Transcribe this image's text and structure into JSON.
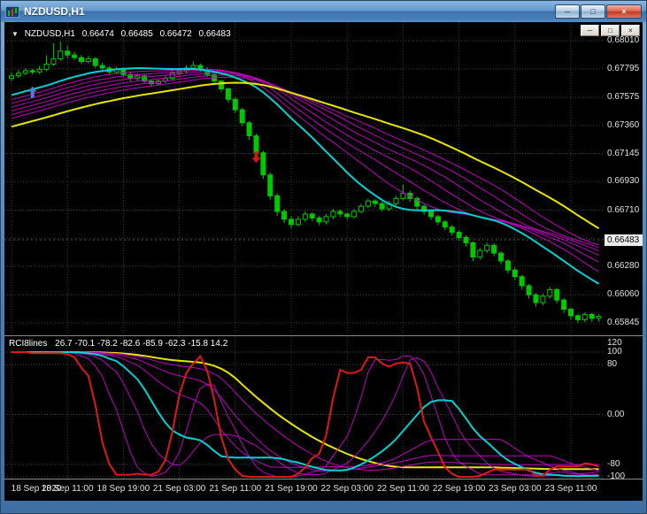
{
  "window": {
    "title": "NZDUSD,H1",
    "buttons": {
      "minimize": "─",
      "restore": "□",
      "close": "×"
    }
  },
  "child_buttons": {
    "minimize": "─",
    "restore": "□",
    "close": "×"
  },
  "quote": {
    "dropdown": "▼",
    "symbol": "NZDUSD,H1",
    "open": "0.66474",
    "high": "0.66485",
    "low": "0.66472",
    "close": "0.66483"
  },
  "colors": {
    "background": "#000000",
    "grid": "#274427",
    "candle": "#00C800",
    "ma_ribbon": "#C000C0",
    "ma_fast": "#00D2D2",
    "ma_slow": "#E6E600",
    "rci_fast": "#E01818",
    "arrow_up": "#4C82C8",
    "arrow_down": "#DC1414",
    "axis_text": "#E2E2E2",
    "bid_box": "#ECECEC"
  },
  "chart_data": {
    "type": "candlestick",
    "symbol": "NZDUSD",
    "timeframe": "H1",
    "price_axis": {
      "scale": {
        "max": 0.6801,
        "min": 0.65845
      },
      "labels": [
        "0.68010",
        "0.67795",
        "0.67575",
        "0.67360",
        "0.67145",
        "0.66930",
        "0.66710",
        "0.66280",
        "0.66060",
        "0.65845"
      ],
      "grid_values": [
        0.6801,
        0.67795,
        0.67575,
        0.6736,
        0.67145,
        0.6693,
        0.6671,
        0.66495,
        0.6628,
        0.6606,
        0.65845
      ],
      "bid": {
        "text": "0.66483",
        "value": 0.66483
      }
    },
    "time_axis": {
      "ticks": [
        0,
        8,
        16,
        24,
        32,
        40,
        48,
        56,
        64,
        72,
        80
      ],
      "labels": [
        "18 Sep 2020",
        "18 Sep 11:00",
        "18 Sep 19:00",
        "21 Sep 03:00",
        "21 Sep 11:00",
        "21 Sep 19:00",
        "22 Sep 03:00",
        "22 Sep 11:00",
        "22 Sep 19:00",
        "23 Sep 03:00",
        "23 Sep 11:00"
      ]
    },
    "pre_closes": [
      0.6695,
      0.66964,
      0.66979,
      0.66993,
      0.67007,
      0.67021,
      0.67036,
      0.6705,
      0.67064,
      0.67079,
      0.67093,
      0.67107,
      0.67121,
      0.67136,
      0.6715,
      0.67164,
      0.67179,
      0.67193,
      0.67207,
      0.67221,
      0.67236,
      0.6725,
      0.67264,
      0.67279,
      0.67293,
      0.67307,
      0.67321,
      0.67336,
      0.6735,
      0.67364,
      0.67379,
      0.67393,
      0.67407,
      0.67421,
      0.67436,
      0.6745,
      0.67464,
      0.67479,
      0.67493,
      0.67507,
      0.67521,
      0.67536,
      0.6755,
      0.67564,
      0.67579,
      0.67593,
      0.67607,
      0.67621,
      0.67636,
      0.6765,
      0.67664,
      0.67679,
      0.67693,
      0.67707,
      0.6772
    ],
    "ohlc": [
      [
        0.6772,
        0.67765,
        0.677,
        0.6774
      ],
      [
        0.6774,
        0.67785,
        0.67725,
        0.6776
      ],
      [
        0.6776,
        0.678,
        0.67745,
        0.6778
      ],
      [
        0.6778,
        0.67795,
        0.6775,
        0.6777
      ],
      [
        0.6777,
        0.67815,
        0.67755,
        0.6779
      ],
      [
        0.6779,
        0.679,
        0.67775,
        0.6783
      ],
      [
        0.6783,
        0.6799,
        0.67815,
        0.6787
      ],
      [
        0.6787,
        0.68005,
        0.67855,
        0.6793
      ],
      [
        0.6793,
        0.6797,
        0.67875,
        0.679
      ],
      [
        0.679,
        0.67925,
        0.6786,
        0.6788
      ],
      [
        0.6788,
        0.679,
        0.6783,
        0.6785
      ],
      [
        0.6785,
        0.67895,
        0.67835,
        0.6787
      ],
      [
        0.6787,
        0.67885,
        0.678,
        0.6782
      ],
      [
        0.6782,
        0.6784,
        0.6778,
        0.678
      ],
      [
        0.678,
        0.67815,
        0.6775,
        0.6777
      ],
      [
        0.6777,
        0.6781,
        0.67755,
        0.6779
      ],
      [
        0.6779,
        0.67805,
        0.6773,
        0.6775
      ],
      [
        0.6775,
        0.67765,
        0.677,
        0.6772
      ],
      [
        0.6772,
        0.6776,
        0.67705,
        0.6774
      ],
      [
        0.6774,
        0.67755,
        0.6768,
        0.677
      ],
      [
        0.677,
        0.67715,
        0.6766,
        0.6768
      ],
      [
        0.6768,
        0.6772,
        0.67665,
        0.677
      ],
      [
        0.677,
        0.6774,
        0.67685,
        0.6772
      ],
      [
        0.6772,
        0.6778,
        0.67705,
        0.6776
      ],
      [
        0.6776,
        0.678,
        0.67745,
        0.6778
      ],
      [
        0.6778,
        0.6782,
        0.67765,
        0.678
      ],
      [
        0.678,
        0.6785,
        0.67785,
        0.6782
      ],
      [
        0.6782,
        0.67835,
        0.6777,
        0.6779
      ],
      [
        0.6779,
        0.67805,
        0.6773,
        0.6775
      ],
      [
        0.6775,
        0.67765,
        0.67675,
        0.677
      ],
      [
        0.677,
        0.6771,
        0.67615,
        0.6764
      ],
      [
        0.6764,
        0.6765,
        0.67535,
        0.6756
      ],
      [
        0.6756,
        0.67575,
        0.67455,
        0.6748
      ],
      [
        0.6748,
        0.67495,
        0.67355,
        0.6738
      ],
      [
        0.6738,
        0.67395,
        0.6725,
        0.6728
      ],
      [
        0.6728,
        0.67295,
        0.6712,
        0.6715
      ],
      [
        0.6715,
        0.67165,
        0.6695,
        0.6698
      ],
      [
        0.6698,
        0.67,
        0.6679,
        0.6682
      ],
      [
        0.6682,
        0.6684,
        0.66665,
        0.667
      ],
      [
        0.667,
        0.6672,
        0.6661,
        0.6664
      ],
      [
        0.6664,
        0.66665,
        0.6657,
        0.666
      ],
      [
        0.666,
        0.66665,
        0.66585,
        0.6664
      ],
      [
        0.6664,
        0.667,
        0.6662,
        0.6668
      ],
      [
        0.6668,
        0.66695,
        0.66625,
        0.6665
      ],
      [
        0.6665,
        0.66665,
        0.66595,
        0.6662
      ],
      [
        0.6662,
        0.6668,
        0.666,
        0.6666
      ],
      [
        0.6666,
        0.6672,
        0.6664,
        0.667
      ],
      [
        0.667,
        0.66715,
        0.66655,
        0.6668
      ],
      [
        0.6668,
        0.66695,
        0.66635,
        0.6666
      ],
      [
        0.6666,
        0.6672,
        0.66645,
        0.667
      ],
      [
        0.667,
        0.6676,
        0.66685,
        0.6674
      ],
      [
        0.6674,
        0.668,
        0.66725,
        0.6678
      ],
      [
        0.6678,
        0.66795,
        0.66735,
        0.6676
      ],
      [
        0.6676,
        0.66775,
        0.667,
        0.6672
      ],
      [
        0.6672,
        0.6678,
        0.66705,
        0.6676
      ],
      [
        0.6676,
        0.6682,
        0.66745,
        0.668
      ],
      [
        0.668,
        0.66905,
        0.66785,
        0.6684
      ],
      [
        0.6684,
        0.6686,
        0.66775,
        0.668
      ],
      [
        0.668,
        0.66815,
        0.66715,
        0.6674
      ],
      [
        0.6674,
        0.66755,
        0.66675,
        0.667
      ],
      [
        0.667,
        0.66715,
        0.66635,
        0.6666
      ],
      [
        0.6666,
        0.66675,
        0.66595,
        0.6662
      ],
      [
        0.6662,
        0.66635,
        0.66555,
        0.6658
      ],
      [
        0.6658,
        0.66595,
        0.66515,
        0.6654
      ],
      [
        0.6654,
        0.66555,
        0.66475,
        0.665
      ],
      [
        0.665,
        0.66515,
        0.6643,
        0.6646
      ],
      [
        0.6646,
        0.6647,
        0.6632,
        0.6635
      ],
      [
        0.6635,
        0.6642,
        0.6633,
        0.664
      ],
      [
        0.664,
        0.6646,
        0.6638,
        0.6644
      ],
      [
        0.6644,
        0.66455,
        0.66355,
        0.6638
      ],
      [
        0.6638,
        0.66395,
        0.66295,
        0.6632
      ],
      [
        0.6632,
        0.66335,
        0.66225,
        0.6625
      ],
      [
        0.6625,
        0.6627,
        0.66175,
        0.662
      ],
      [
        0.662,
        0.66215,
        0.661,
        0.6613
      ],
      [
        0.6613,
        0.66145,
        0.6603,
        0.6606
      ],
      [
        0.6606,
        0.66075,
        0.6597,
        0.66
      ],
      [
        0.66,
        0.6607,
        0.6598,
        0.6605
      ],
      [
        0.6605,
        0.6612,
        0.6603,
        0.661
      ],
      [
        0.661,
        0.66115,
        0.65995,
        0.6602
      ],
      [
        0.6602,
        0.66035,
        0.6592,
        0.6595
      ],
      [
        0.6595,
        0.65965,
        0.6587,
        0.659
      ],
      [
        0.659,
        0.65915,
        0.65845,
        0.6587
      ],
      [
        0.6587,
        0.65925,
        0.6585,
        0.6591
      ],
      [
        0.6591,
        0.6592,
        0.65855,
        0.6588
      ],
      [
        0.6588,
        0.6591,
        0.65855,
        0.65895
      ]
    ],
    "overlays": [
      {
        "type": "sma",
        "period": 46,
        "color": "#C000C0",
        "width": 1
      },
      {
        "type": "sma",
        "period": 42,
        "color": "#C000C0",
        "width": 1
      },
      {
        "type": "sma",
        "period": 38,
        "color": "#C000C0",
        "width": 1
      },
      {
        "type": "sma",
        "period": 34,
        "color": "#C000C0",
        "width": 1
      },
      {
        "type": "sma",
        "period": 30,
        "color": "#C000C0",
        "width": 1
      },
      {
        "type": "sma",
        "period": 26,
        "color": "#C000C0",
        "width": 1
      },
      {
        "type": "sma",
        "period": 21,
        "color": "#00D2D2",
        "width": 2
      },
      {
        "type": "sma",
        "period": 55,
        "color": "#E6E600",
        "width": 2
      }
    ],
    "markers": [
      {
        "shape": "arrow-up",
        "index": 3,
        "price": 0.6766,
        "color": "#4C82C8"
      },
      {
        "shape": "arrow-down",
        "index": 35,
        "price": 0.6716,
        "color": "#DC1414"
      }
    ],
    "indicator": {
      "name": "RCI8lines",
      "values_text": "26.7 -70.1 -78.2 -82.6 -85.9 -62.3 -15.8 14.2",
      "axis_labels": [
        {
          "text": "120",
          "value": 120
        },
        {
          "text": "100",
          "value": 100
        },
        {
          "text": "80",
          "value": 80
        },
        {
          "text": "0.00",
          "value": 0
        },
        {
          "text": "-80",
          "value": -80
        },
        {
          "text": "-100",
          "value": -100
        }
      ],
      "levels": [
        100,
        80,
        0,
        -80,
        -100
      ],
      "lines": [
        {
          "period": 56,
          "color": "#E6E600",
          "width": 2
        },
        {
          "period": 48,
          "color": "#C000C0",
          "width": 1
        },
        {
          "period": 40,
          "color": "#C000C0",
          "width": 1
        },
        {
          "period": 33,
          "color": "#C000C0",
          "width": 1
        },
        {
          "period": 20,
          "color": "#C000C0",
          "width": 1
        },
        {
          "period": 14,
          "color": "#C000C0",
          "width": 1
        },
        {
          "period": 26,
          "color": "#00D2D2",
          "width": 2
        },
        {
          "period": 9,
          "color": "#E01818",
          "width": 2
        }
      ]
    }
  }
}
